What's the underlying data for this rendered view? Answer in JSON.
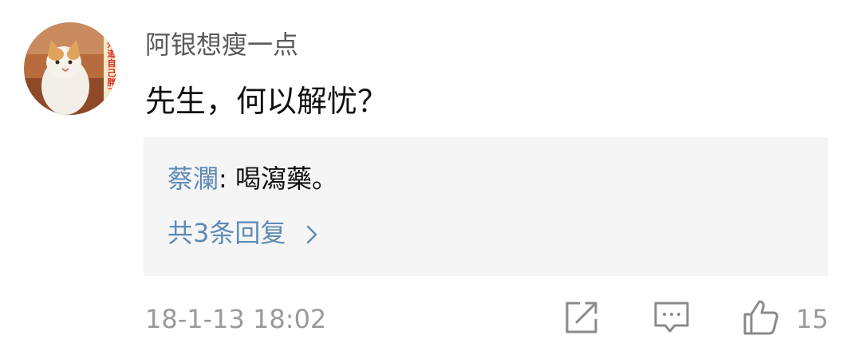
{
  "comment": {
    "avatar_caption": "我知道自己胖了",
    "username": "阿银想瘦一点",
    "text": "先生，何以解忧？",
    "timestamp": "18-1-13 18:02",
    "like_count": "15"
  },
  "reply_preview": {
    "author": "蔡瀾",
    "separator": ": ",
    "text": "喝瀉藥。",
    "view_all": "共3条回复"
  },
  "icons": {
    "share": "share-icon",
    "comment": "comment-icon",
    "like": "thumbs-up-icon",
    "chevron": "chevron-right-icon"
  },
  "colors": {
    "link": "#5f8ab8",
    "meta": "#9a9a9a",
    "reply_bg": "#f5f5f5"
  }
}
